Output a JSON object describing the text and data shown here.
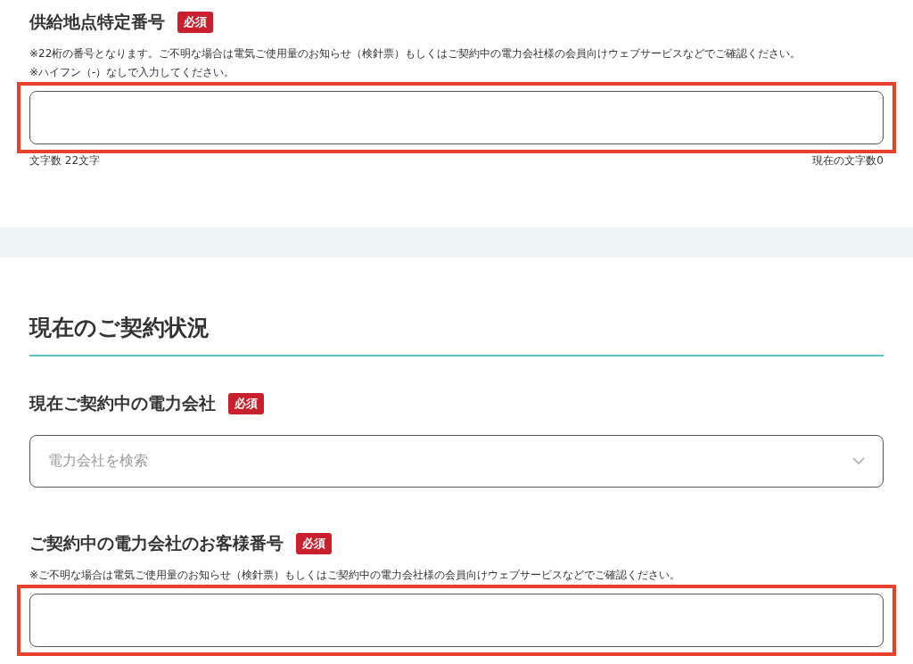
{
  "supply_point": {
    "kind": "text",
    "label": "供給地点特定番号",
    "badge": "必須",
    "notes": [
      "※22桁の番号となります。ご不明な場合は電気ご使用量のお知らせ（検針票）もしくはご契約中の電力会社様の会員向けウェブサービスなどでご確認ください。",
      "※ハイフン（-）なしで入力してください。"
    ],
    "highlighted": true,
    "counter_left": "文字数 22文字",
    "counter_right": "現在の文字数0"
  },
  "current_contract": {
    "heading": "現在のご契約状況",
    "fields": [
      {
        "kind": "select",
        "label": "現在ご契約中の電力会社",
        "badge": "必須",
        "placeholder": "電力会社を検索",
        "highlighted": false
      },
      {
        "kind": "text",
        "label": "ご契約中の電力会社のお客様番号",
        "badge": "必須",
        "notes": [
          "※ご不明な場合は電気ご使用量のお知らせ（検針票）もしくはご契約中の電力会社様の会員向けウェブサービスなどでご確認ください。"
        ],
        "highlighted": true
      }
    ]
  }
}
